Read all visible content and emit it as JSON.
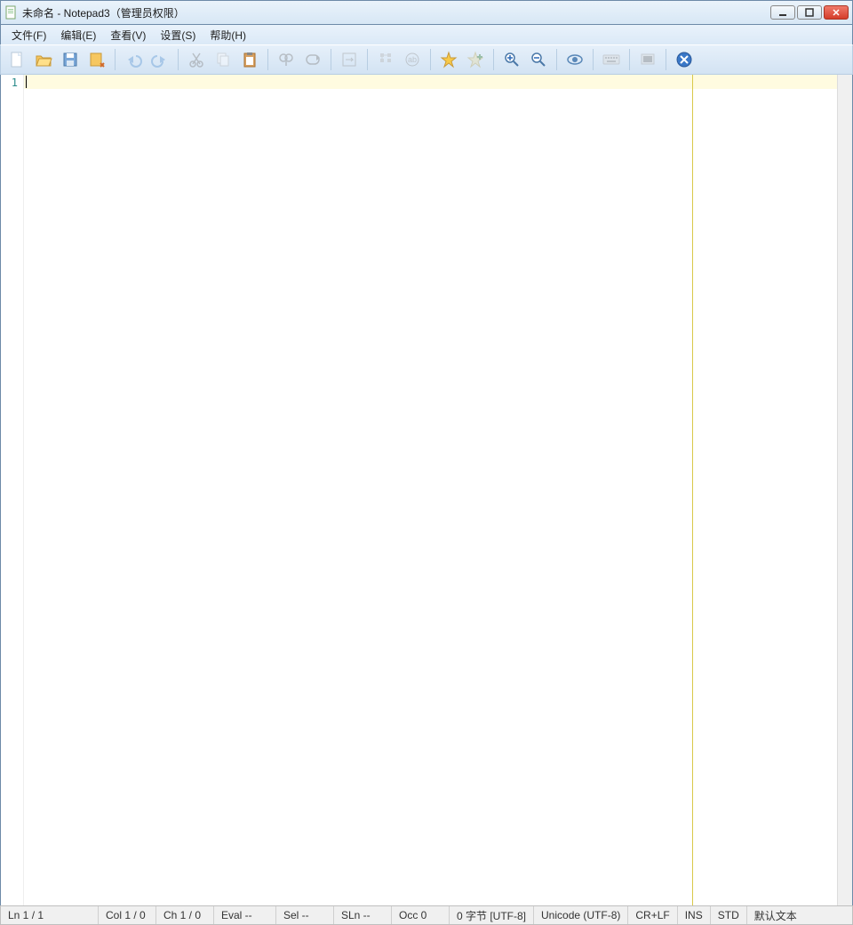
{
  "titlebar": {
    "title": "未命名 - Notepad3（管理员权限）"
  },
  "menu": {
    "file": "文件(F)",
    "edit": "编辑(E)",
    "view": "查看(V)",
    "settings": "设置(S)",
    "help": "帮助(H)"
  },
  "toolbar_icons": {
    "new": "new-file-icon",
    "open": "open-folder-icon",
    "save": "save-icon",
    "revert": "revert-icon",
    "undo": "undo-icon",
    "redo": "redo-icon",
    "cut": "cut-icon",
    "copy": "copy-icon",
    "paste": "paste-icon",
    "find": "find-icon",
    "replace": "replace-icon",
    "wordwrap": "wordwrap-icon",
    "guides": "guides-icon",
    "chars": "chars-icon",
    "fav": "favorite-icon",
    "addfav": "add-favorite-icon",
    "zoomin": "zoom-in-icon",
    "zoomout": "zoom-out-icon",
    "scheme": "eye-icon",
    "onscreen": "keyboard-icon",
    "run": "run-icon",
    "exit": "exit-icon"
  },
  "editor": {
    "line_number": "1"
  },
  "status": {
    "ln": "Ln  1 / 1",
    "col": "Col  1 / 0",
    "ch": "Ch  1 / 0",
    "eval": "Eval  --",
    "sel": "Sel  --",
    "sln": "SLn  --",
    "occ": "Occ  0",
    "bytes": "0 字节 [UTF-8]",
    "enc": "Unicode (UTF-8)",
    "eol": "CR+LF",
    "ins": "INS",
    "std": "STD",
    "lexer": "默认文本"
  }
}
